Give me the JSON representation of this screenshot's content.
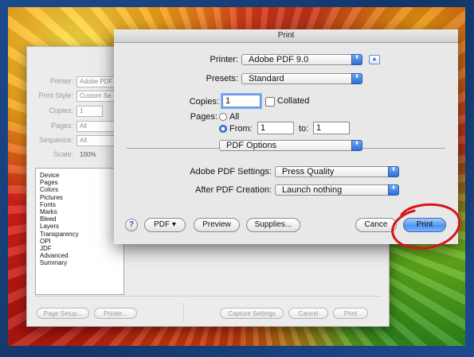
{
  "background_dialog": {
    "labels": {
      "printer": "Printer:",
      "print_style": "Print Style:",
      "copies": "Copies:",
      "pages": "Pages:",
      "sequence": "Sequence:",
      "scale": "Scale:"
    },
    "values": {
      "printer": "Adobe PDF",
      "print_style": "Custom Se",
      "copies": "1",
      "pages": "All",
      "sequence": "All",
      "scale": "100%"
    },
    "list_items": [
      "Device",
      "Pages",
      "Colors",
      "Pictures",
      "Fonts",
      "Marks",
      "Bleed",
      "Layers",
      "Transparency",
      "OPI",
      "JDF",
      "Advanced",
      "Summary"
    ],
    "buttons": {
      "page_setup": "Page Setup...",
      "printer": "Printer...",
      "capture_settings": "Capture Settings",
      "cancel": "Cancel",
      "print": "Print"
    }
  },
  "print_dialog": {
    "title": "Print",
    "printer_label": "Printer:",
    "printer_value": "Adobe PDF 9.0",
    "presets_label": "Presets:",
    "presets_value": "Standard",
    "copies_label": "Copies:",
    "copies_value": "1",
    "collated_label": "Collated",
    "pages_label": "Pages:",
    "pages_all_label": "All",
    "pages_from_label": "From:",
    "pages_from_value": "1",
    "pages_to_label": "to:",
    "pages_to_value": "1",
    "options_popup": "PDF Options",
    "adobe_pdf_settings_label": "Adobe PDF Settings:",
    "adobe_pdf_settings_value": "Press Quality",
    "after_pdf_creation_label": "After PDF Creation:",
    "after_pdf_creation_value": "Launch nothing",
    "help_label": "?",
    "pdf_button": "PDF ▾",
    "preview_button": "Preview",
    "supplies_button": "Supplies...",
    "cancel_button": "Cance",
    "print_button": "Print"
  },
  "icons": {
    "popup_arrow": "⬍",
    "disclosure": "▲"
  },
  "colors": {
    "accent_blue": "#4f93ee",
    "annotation_red": "#d9141c"
  }
}
